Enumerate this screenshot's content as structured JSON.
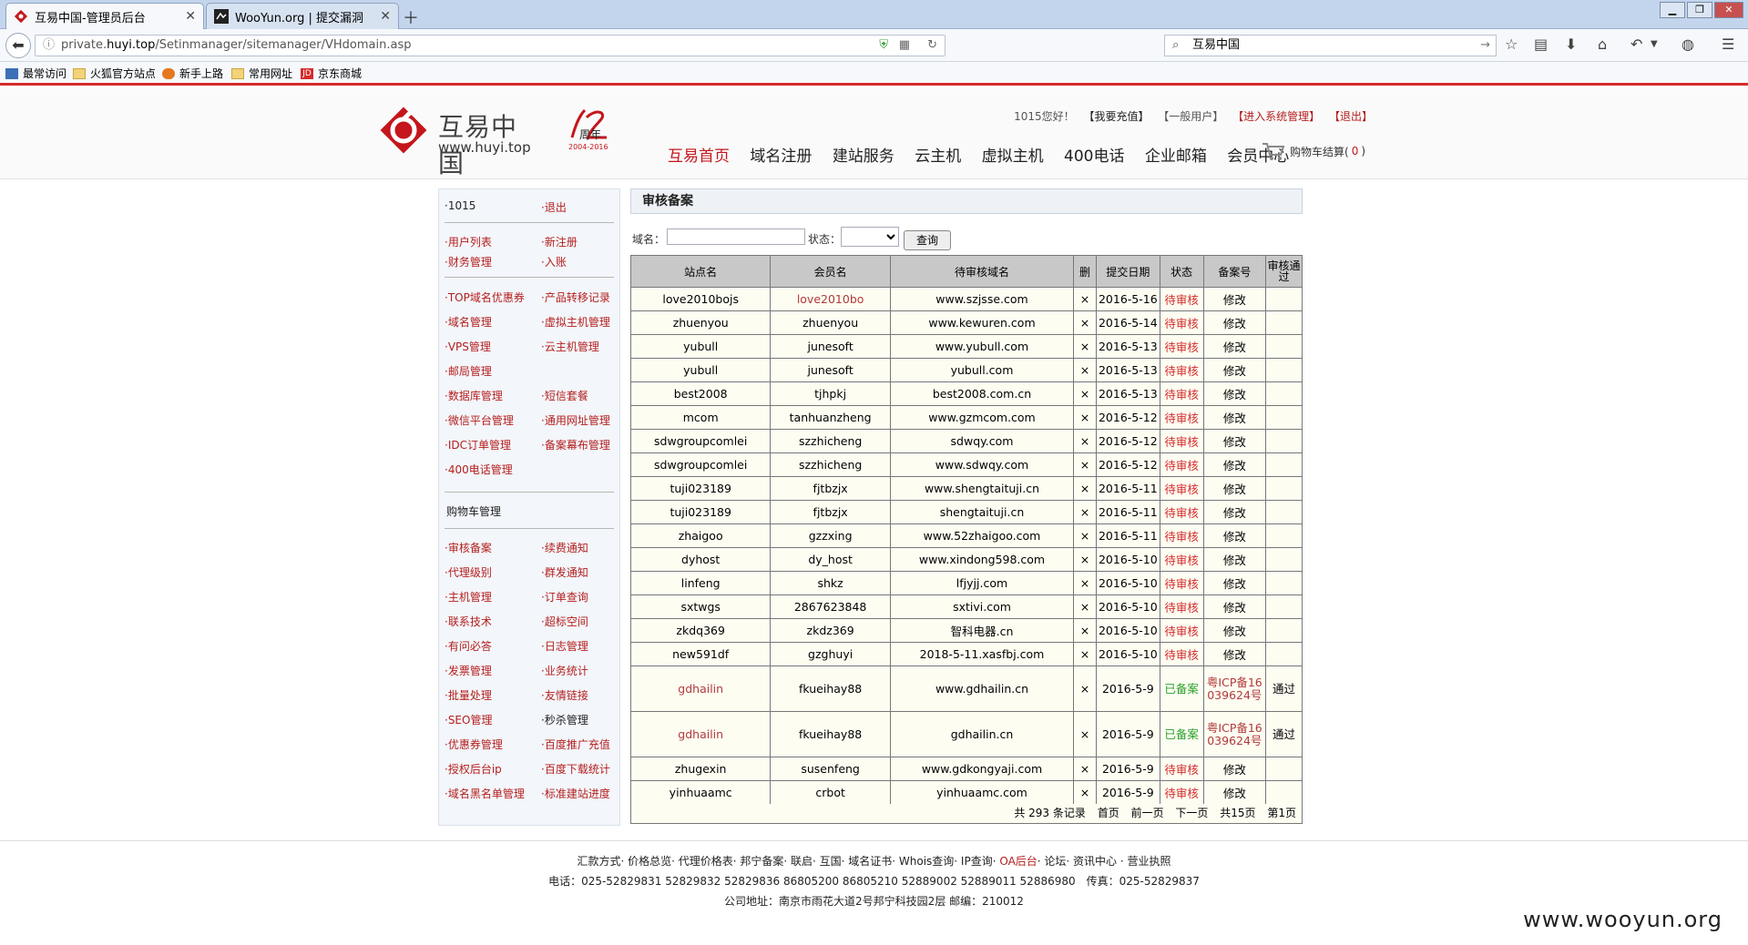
{
  "browser": {
    "tabs": [
      {
        "title": "互易中国-管理员后台"
      },
      {
        "title": "WooYun.org | 提交漏洞"
      }
    ],
    "url_prefix": "private.",
    "url_domain": "huyi.top",
    "url_path": "/Setinmanager/sitemanager/VHdomain.asp",
    "search_text": "互易中国",
    "bookmarks": [
      "最常访问",
      "火狐官方站点",
      "新手上路",
      "常用网址",
      "京东商城"
    ]
  },
  "header": {
    "logo_cn": "互易中国",
    "logo_url": "www.huyi.top",
    "anniv_years": "2004-2016",
    "anniv_label": "周年",
    "greeting": "1015您好！",
    "recharge": "【我要充值】",
    "usertype": "【一般用户】",
    "admin_link": "【进入系统管理】",
    "logout": "【退出】",
    "nav": [
      "互易首页",
      "域名注册",
      "建站服务",
      "云主机",
      "虚拟主机",
      "400电话",
      "企业邮箱",
      "会员中心"
    ],
    "cart_label": "购物车结算(",
    "cart_count": "0",
    "cart_close": ")"
  },
  "sidebar": {
    "user": "·1015",
    "logout": "·退出",
    "groups": [
      [
        [
          "·用户列表",
          "·新注册"
        ],
        [
          "·财务管理",
          "·入账"
        ]
      ],
      [
        [
          "·TOP域名优惠券",
          "·产品转移记录"
        ],
        [
          "·域名管理",
          "·虚拟主机管理"
        ],
        [
          "·VPS管理",
          "·云主机管理"
        ],
        [
          "·邮局管理",
          ""
        ],
        [
          "·数据库管理",
          "·短信套餐"
        ],
        [
          "·微信平台管理",
          "·通用网址管理"
        ],
        [
          "·IDC订单管理",
          "·备案幕布管理"
        ],
        [
          "·400电话管理",
          ""
        ]
      ],
      [
        [
          "购物车管理",
          ""
        ]
      ],
      [
        [
          "·审核备案",
          "·续费通知"
        ],
        [
          "·代理级别",
          "·群发通知"
        ],
        [
          "·主机管理",
          "·订单查询"
        ],
        [
          "·联系技术",
          "·超标空间"
        ],
        [
          "·有问必答",
          "·日志管理"
        ],
        [
          "·发票管理",
          "·业务统计"
        ],
        [
          "·批量处理",
          "·友情链接"
        ],
        [
          "·SEO管理",
          "·秒杀管理"
        ],
        [
          "·优惠券管理",
          "·百度推广充值"
        ],
        [
          "·授权后台ip",
          "·百度下载统计"
        ],
        [
          "·域名黑名单管理",
          "·标准建站进度"
        ]
      ]
    ]
  },
  "main": {
    "title": "审核备案",
    "domain_label": "域名：",
    "status_label": "状态：",
    "query_button": "查询",
    "columns": [
      "站点名",
      "会员名",
      "待审核域名",
      "删",
      "提交日期",
      "状态",
      "备案号",
      "审核通过"
    ],
    "rows": [
      [
        "love2010bojs",
        "love2010bo",
        "www.szjsse.com",
        "×",
        "2016-5-16",
        "待审核",
        "修改",
        ""
      ],
      [
        "zhuenyou",
        "zhuenyou",
        "www.kewuren.com",
        "×",
        "2016-5-14",
        "待审核",
        "修改",
        ""
      ],
      [
        "yubull",
        "junesoft",
        "www.yubull.com",
        "×",
        "2016-5-13",
        "待审核",
        "修改",
        ""
      ],
      [
        "yubull",
        "junesoft",
        "yubull.com",
        "×",
        "2016-5-13",
        "待审核",
        "修改",
        ""
      ],
      [
        "best2008",
        "tjhpkj",
        "best2008.com.cn",
        "×",
        "2016-5-13",
        "待审核",
        "修改",
        ""
      ],
      [
        "mcom",
        "tanhuanzheng",
        "www.gzmcom.com",
        "×",
        "2016-5-12",
        "待审核",
        "修改",
        ""
      ],
      [
        "sdwgroupcomlei",
        "szzhicheng",
        "sdwqy.com",
        "×",
        "2016-5-12",
        "待审核",
        "修改",
        ""
      ],
      [
        "sdwgroupcomlei",
        "szzhicheng",
        "www.sdwqy.com",
        "×",
        "2016-5-12",
        "待审核",
        "修改",
        ""
      ],
      [
        "tuji023189",
        "fjtbzjx",
        "www.shengtaituji.cn",
        "×",
        "2016-5-11",
        "待审核",
        "修改",
        ""
      ],
      [
        "tuji023189",
        "fjtbzjx",
        "shengtaituji.cn",
        "×",
        "2016-5-11",
        "待审核",
        "修改",
        ""
      ],
      [
        "zhaigoo",
        "gzzxing",
        "www.52zhaigoo.com",
        "×",
        "2016-5-11",
        "待审核",
        "修改",
        ""
      ],
      [
        "dyhost",
        "dy_host",
        "www.xindong598.com",
        "×",
        "2016-5-10",
        "待审核",
        "修改",
        ""
      ],
      [
        "linfeng",
        "shkz",
        "lfjyjj.com",
        "×",
        "2016-5-10",
        "待审核",
        "修改",
        ""
      ],
      [
        "sxtwgs",
        "2867623848",
        "sxtivi.com",
        "×",
        "2016-5-10",
        "待审核",
        "修改",
        ""
      ],
      [
        "zkdq369",
        "zkdz369",
        "智科电器.cn",
        "×",
        "2016-5-10",
        "待审核",
        "修改",
        ""
      ],
      [
        "new591df",
        "gzghuyi",
        "2018-5-11.xasfbj.com",
        "×",
        "2016-5-10",
        "待审核",
        "修改",
        ""
      ],
      [
        "gdhailin",
        "fkueihay88",
        "www.gdhailin.cn",
        "×",
        "2016-5-9",
        "已备案",
        "粤ICP备16039624号",
        "通过"
      ],
      [
        "gdhailin",
        "fkueihay88",
        "gdhailin.cn",
        "×",
        "2016-5-9",
        "已备案",
        "粤ICP备16039624号",
        "通过"
      ],
      [
        "zhugexin",
        "susenfeng",
        "www.gdkongyaji.com",
        "×",
        "2016-5-9",
        "待审核",
        "修改",
        ""
      ],
      [
        "yinhuaamc",
        "crbot",
        "yinhuaamc.com",
        "×",
        "2016-5-9",
        "待审核",
        "修改",
        ""
      ]
    ],
    "pager": [
      "共 293 条记录",
      "首页",
      "前一页",
      "下一页",
      "共15页",
      "第1页"
    ]
  },
  "footer": {
    "links": "汇款方式· 价格总览· 代理价格表· 邦宁备案· 联启· 互国· 域名证书· Whois查询· IP查询·",
    "oa": " OA后台",
    "links_end": "· 论坛· 资讯中心 · 营业执照",
    "phone": "电话：025-52829831 52829832 52829836 86805200 86805210 52889002 52889011 52886980　传真：025-52829837",
    "address": "公司地址：南京市雨花大道2号邦宁科技园2层 邮编：210012",
    "watermark": "www.wooyun.org"
  },
  "colors": {
    "accent": "#c4161c",
    "tabbar": "#c3d5ec",
    "table_bg": "#fdfdf2",
    "header_cell": "#c8c8c8"
  }
}
